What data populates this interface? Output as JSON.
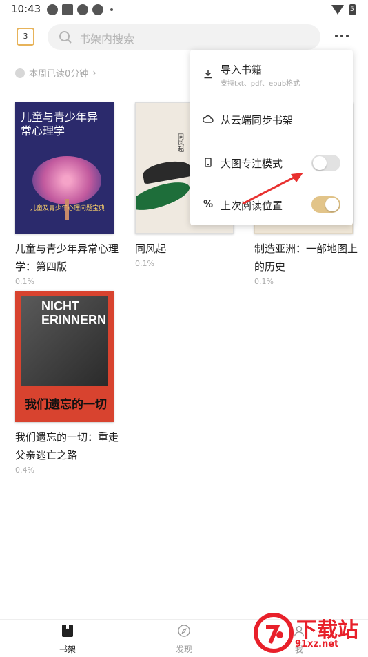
{
  "status": {
    "time": "10:43",
    "battery": "5"
  },
  "header": {
    "calendar_day": "3",
    "search_placeholder": "书架内搜索"
  },
  "weekly": {
    "text": "本周已读0分钟",
    "chevron": "›"
  },
  "books": [
    {
      "title": "儿童与青少年异常心理学：第四版",
      "progress": "0.1%",
      "cover_title": "儿童与青少年异常心理学",
      "cover_sub": "儿童及青少年心理问题宝典"
    },
    {
      "title": "同风起",
      "progress": "0.1%",
      "cover_title": "同风起"
    },
    {
      "title": "制造亚洲：一部地图上的历史",
      "progress": "0.1%"
    },
    {
      "title": "我们遗忘的一切：重走父亲逃亡之路",
      "progress": "0.4%",
      "cover_head": "NICHT ERINNERN",
      "cover_title": "我们遗忘的一切"
    }
  ],
  "menu": {
    "import": {
      "label": "导入书籍",
      "sub": "支持txt、pdf、epub格式"
    },
    "cloud_sync": {
      "label": "从云端同步书架"
    },
    "focus_mode": {
      "label": "大图专注模式",
      "enabled": false
    },
    "last_position": {
      "label": "上次阅读位置",
      "enabled": true
    }
  },
  "tabs": [
    {
      "label": "书架",
      "active": true
    },
    {
      "label": "发现",
      "active": false
    },
    {
      "label": "我",
      "active": false
    }
  ],
  "watermark": {
    "text": "下载站",
    "url": "91xz.net"
  },
  "colors": {
    "accent": "#e2c489",
    "watermark": "#e8202a",
    "arrow": "#e8302f"
  }
}
